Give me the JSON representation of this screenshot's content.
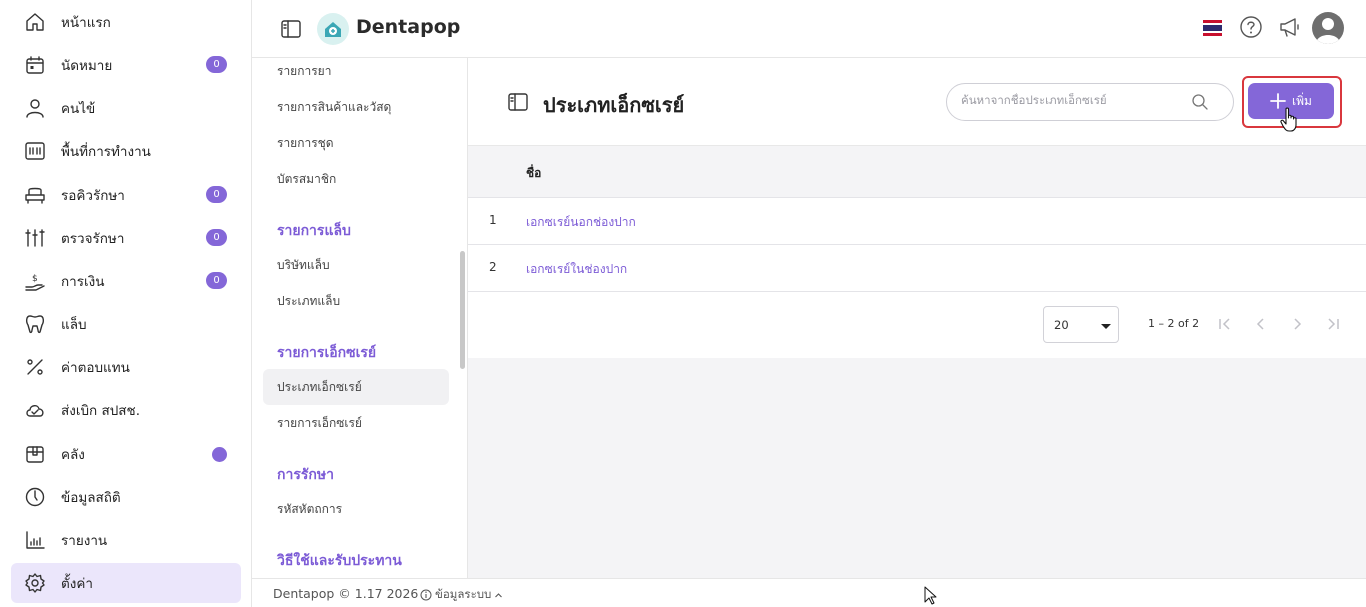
{
  "nav": {
    "items": [
      {
        "label": "หน้าแรก",
        "icon": "home-icon"
      },
      {
        "label": "นัดหมาย",
        "icon": "calendar-icon",
        "badge": "0"
      },
      {
        "label": "คนไข้",
        "icon": "user-icon"
      },
      {
        "label": "พื้นที่การทำงาน",
        "icon": "workspace-icon"
      },
      {
        "label": "รอคิวรักษา",
        "icon": "queue-chair-icon",
        "badge": "0"
      },
      {
        "label": "ตรวจรักษา",
        "icon": "dental-tools-icon",
        "badge": "0"
      },
      {
        "label": "การเงิน",
        "icon": "money-hand-icon",
        "badge": "0"
      },
      {
        "label": "แล็บ",
        "icon": "tooth-icon"
      },
      {
        "label": "ค่าตอบแทน",
        "icon": "percent-icon"
      },
      {
        "label": "ส่งเบิก สปสช.",
        "icon": "cloud-check-icon"
      },
      {
        "label": "คลัง",
        "icon": "box-icon"
      },
      {
        "label": "ข้อมูลสถิติ",
        "icon": "gauge-icon"
      },
      {
        "label": "รายงาน",
        "icon": "bar-chart-icon"
      },
      {
        "label": "ตั้งค่า",
        "icon": "gear-icon"
      }
    ]
  },
  "topbar": {
    "brand": "Dentapop"
  },
  "settings_menu": {
    "items": [
      {
        "type": "link",
        "label": "รายการยา"
      },
      {
        "type": "link",
        "label": "รายการสินค้าและวัสดุ"
      },
      {
        "type": "link",
        "label": "รายการชุด"
      },
      {
        "type": "link",
        "label": "บัตรสมาชิก"
      },
      {
        "type": "head",
        "label": "รายการแล็บ"
      },
      {
        "type": "link",
        "label": "บริษัทแล็บ"
      },
      {
        "type": "link",
        "label": "ประเภทแล็บ"
      },
      {
        "type": "head",
        "label": "รายการเอ็กซเรย์"
      },
      {
        "type": "link",
        "label": "ประเภทเอ็กซเรย์"
      },
      {
        "type": "link",
        "label": "รายการเอ็กซเรย์"
      },
      {
        "type": "head",
        "label": "การรักษา"
      },
      {
        "type": "link",
        "label": "รหัสหัตถการ"
      },
      {
        "type": "head",
        "label": "วิธีใช้และรับประทาน"
      }
    ]
  },
  "main": {
    "title": "ประเภทเอ็กซเรย์",
    "search_placeholder": "ค้นหาจากชื่อประเภทเอ็กซเรย์",
    "add_label": "เพิ่ม",
    "column_name": "ชื่อ",
    "rows": [
      {
        "index": "1",
        "name": "เอกซเรย์นอกช่องปาก"
      },
      {
        "index": "2",
        "name": "เอกซเรย์ในช่องปาก"
      }
    ],
    "page_size": "20",
    "range_text": "1 – 2 of 2"
  },
  "footer": {
    "copyright": "Dentapop © 1.17 2026",
    "info": "ข้อมูลระบบ"
  },
  "colors": {
    "accent": "#8467d8",
    "highlight": "#d9373d"
  }
}
